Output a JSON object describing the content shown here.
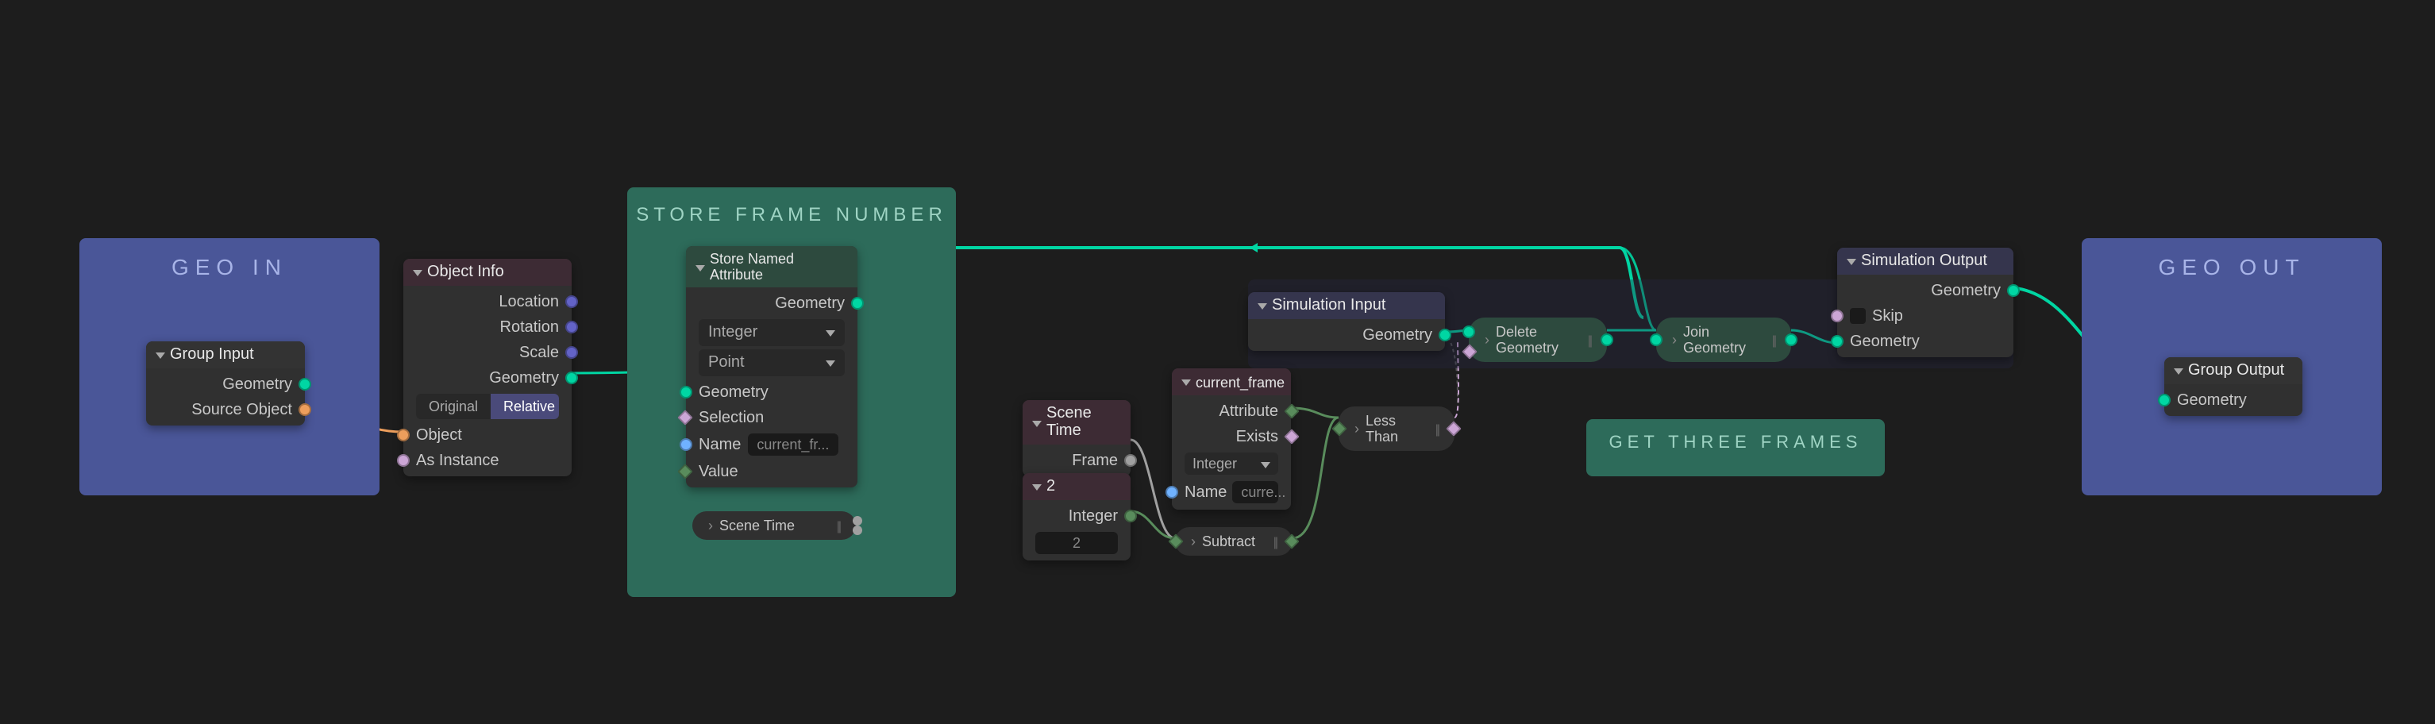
{
  "frames": {
    "geo_in": {
      "label": "GEO IN"
    },
    "store_frame": {
      "label": "STORE FRAME NUMBER"
    },
    "get_three": {
      "label": "GET THREE FRAMES"
    },
    "geo_out": {
      "label": "GEO OUT"
    }
  },
  "nodes": {
    "group_input": {
      "title": "Group Input",
      "outputs": {
        "geometry": "Geometry",
        "source_object": "Source Object"
      }
    },
    "object_info": {
      "title": "Object Info",
      "outputs": {
        "location": "Location",
        "rotation": "Rotation",
        "scale": "Scale",
        "geometry": "Geometry"
      },
      "transform": {
        "original": "Original",
        "relative": "Relative"
      },
      "inputs": {
        "object": "Object",
        "as_instance": "As Instance"
      }
    },
    "store_named": {
      "title": "Store Named Attribute",
      "outputs": {
        "geometry": "Geometry"
      },
      "type_dd": "Integer",
      "domain_dd": "Point",
      "inputs": {
        "geometry": "Geometry",
        "selection": "Selection",
        "name": "Name",
        "value": "Value"
      },
      "name_value": "current_fr..."
    },
    "scene_time_pill": {
      "label": "Scene Time"
    },
    "sim_input": {
      "title": "Simulation Input",
      "outputs": {
        "geometry": "Geometry"
      }
    },
    "scene_time": {
      "title": "Scene Time",
      "outputs": {
        "frame": "Frame"
      }
    },
    "value_2": {
      "title": "2",
      "outputs": {
        "integer": "Integer"
      },
      "value": "2"
    },
    "current_frame": {
      "title": "current_frame",
      "outputs": {
        "attribute": "Attribute",
        "exists": "Exists"
      },
      "type_dd": "Integer",
      "inputs": {
        "name": "Name"
      },
      "name_value": "curre..."
    },
    "subtract": {
      "label": "Subtract"
    },
    "less_than": {
      "label": "Less Than"
    },
    "delete_geo": {
      "label": "Delete Geometry"
    },
    "join_geo": {
      "label": "Join Geometry"
    },
    "sim_output": {
      "title": "Simulation Output",
      "inputs": {
        "skip": "Skip",
        "geometry": "Geometry"
      },
      "outputs": {
        "geometry": "Geometry"
      }
    },
    "group_output": {
      "title": "Group Output",
      "inputs": {
        "geometry": "Geometry"
      }
    }
  },
  "colors": {
    "geo_in_frame": "#4a5698",
    "store_frame": "#2d6b5a",
    "geo_out_frame": "#4a5698"
  }
}
